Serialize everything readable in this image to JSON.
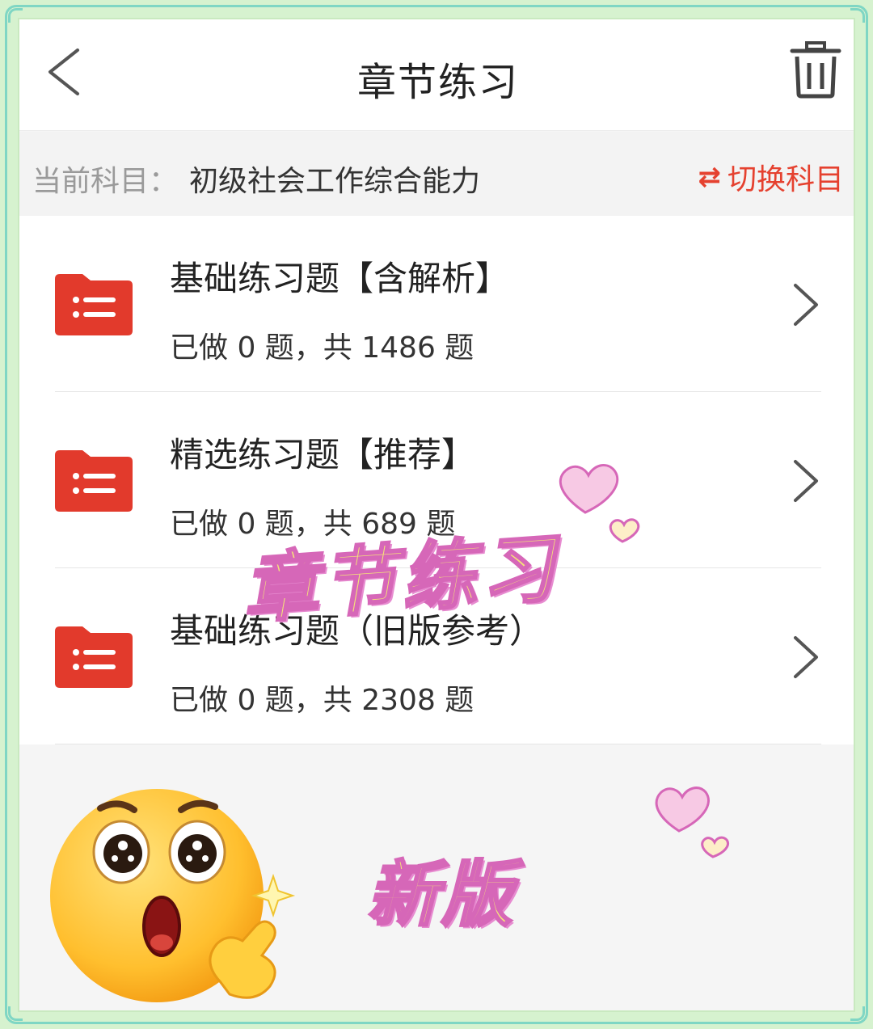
{
  "navbar": {
    "title": "章节练习",
    "back_icon": "chevron-left-icon",
    "trash_icon": "trash-icon"
  },
  "subject": {
    "label": "当前科目：",
    "value": "初级社会工作综合能力",
    "switch_label": "切换科目",
    "switch_icon": "⇄"
  },
  "items": [
    {
      "title": "基础练习题【含解析】",
      "progress": "已做 0 题，共 1486 题"
    },
    {
      "title": "精选练习题【推荐】",
      "progress": "已做 0 题，共 689 题"
    },
    {
      "title": "基础练习题（旧版参考）",
      "progress": "已做 0 题，共 2308 题"
    }
  ],
  "overlay": {
    "title": "章节练习",
    "badge": "新版"
  },
  "colors": {
    "accent": "#e5412f",
    "folder": "#e23a2c",
    "overlay_fill": "#f4e27a",
    "overlay_stroke": "#d667b8"
  }
}
